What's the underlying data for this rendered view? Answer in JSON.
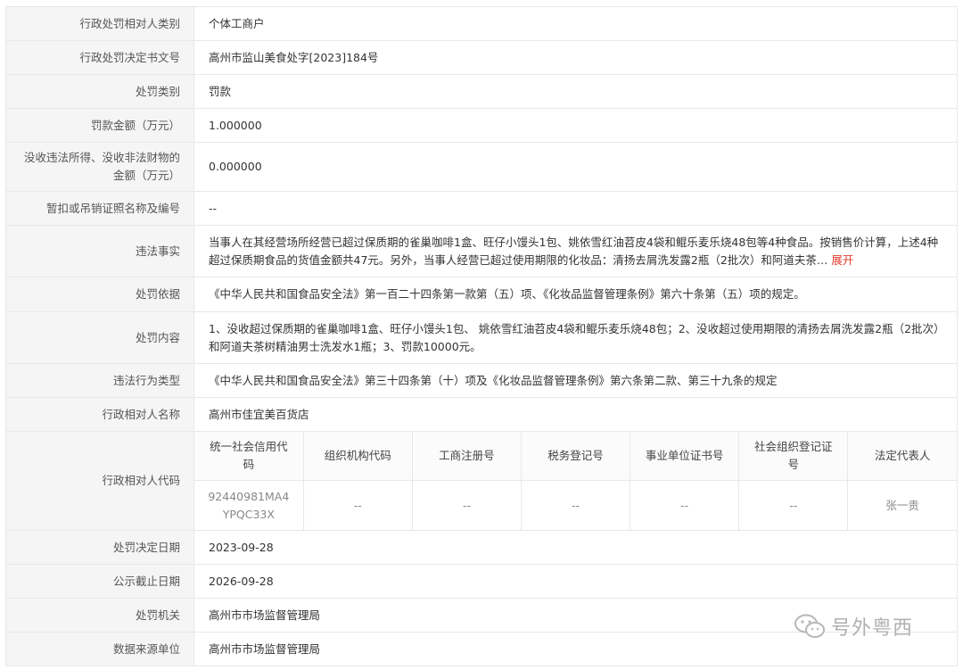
{
  "rows": {
    "r1": {
      "label": "行政处罚相对人类别",
      "value": "个体工商户"
    },
    "r2": {
      "label": "行政处罚决定书文号",
      "value": "高州市监山美食处字[2023]184号"
    },
    "r3": {
      "label": "处罚类别",
      "value": "罚款"
    },
    "r4": {
      "label": "罚款金额（万元）",
      "value": "1.000000"
    },
    "r5": {
      "label": "没收违法所得、没收非法财物的金额（万元）",
      "value": "0.000000"
    },
    "r6": {
      "label": "暂扣或吊销证照名称及编号",
      "value": "--"
    },
    "r7": {
      "label": "违法事实",
      "value": "当事人在其经营场所经营已超过保质期的雀巢咖啡1盒、旺仔小馒头1包、姚依雪红油苕皮4袋和鲲乐麦乐烧48包等4种食品。按销售价计算，上述4种超过保质期食品的货值金额共47元。另外，当事人经营已超过使用期限的化妆品：清扬去屑洗发露2瓶（2批次）和阿道夫茶…",
      "expand": "展开"
    },
    "r8": {
      "label": "处罚依据",
      "value": "《中华人民共和国食品安全法》第一百二十四条第一款第（五）项、《化妆品监督管理条例》第六十条第（五）项的规定。"
    },
    "r9": {
      "label": "处罚内容",
      "value": "1、没收超过保质期的雀巢咖啡1盒、旺仔小馒头1包、 姚依雪红油苕皮4袋和鲲乐麦乐烧48包；2、没收超过使用期限的清扬去屑洗发露2瓶（2批次）和阿道夫茶树精油男士洗发水1瓶；3、罚款10000元。"
    },
    "r10": {
      "label": "违法行为类型",
      "value": "《中华人民共和国食品安全法》第三十四条第（十）项及《化妆品监督管理条例》第六条第二款、第三十九条的规定"
    },
    "r11": {
      "label": "行政相对人名称",
      "value": "高州市佳宜美百货店"
    },
    "r12": {
      "label": "行政相对人代码"
    },
    "r13": {
      "label": "处罚决定日期",
      "value": "2023-09-28"
    },
    "r14": {
      "label": "公示截止日期",
      "value": "2026-09-28"
    },
    "r15": {
      "label": "处罚机关",
      "value": "高州市市场监督管理局"
    },
    "r16": {
      "label": "数据来源单位",
      "value": "高州市市场监督管理局"
    }
  },
  "codes": {
    "headers": [
      "统一社会信用代码",
      "组织机构代码",
      "工商注册号",
      "税务登记号",
      "事业单位证书号",
      "社会组织登记证号",
      "法定代表人"
    ],
    "values": [
      "92440981MA4YPQC33X",
      "--",
      "--",
      "--",
      "--",
      "--",
      "张一贵"
    ]
  },
  "watermark": {
    "text": "号外粤西",
    "icon": "wechat-icon"
  }
}
